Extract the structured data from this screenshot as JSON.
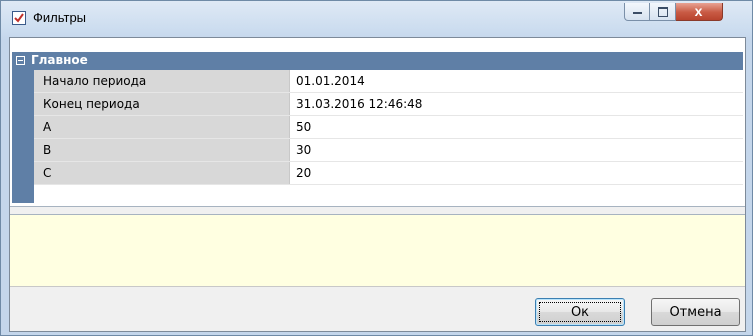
{
  "window": {
    "title": "Фильтры",
    "icon": "checkbox-icon",
    "close_symbol": "x"
  },
  "section": {
    "title": "Главное",
    "icon": "collapse-minus-icon"
  },
  "properties": [
    {
      "label": "Начало периода",
      "value": "01.01.2014"
    },
    {
      "label": "Конец периода",
      "value": "31.03.2016 12:46:48"
    },
    {
      "label": "A",
      "value": "50"
    },
    {
      "label": "B",
      "value": "30"
    },
    {
      "label": "C",
      "value": "20"
    }
  ],
  "buttons": {
    "ok": "Ок",
    "cancel": "Отмена"
  },
  "colors": {
    "section_header": "#5f7fa6",
    "label_cell": "#d8d8d8",
    "description_panel": "#ffffe1",
    "close_button": "#c85a44"
  }
}
